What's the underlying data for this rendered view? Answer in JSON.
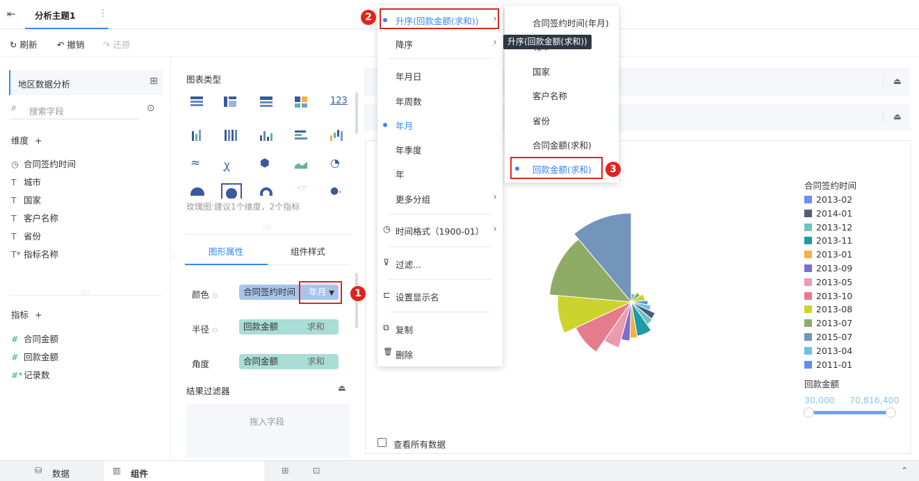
{
  "header": {
    "tab_title": "分析主题1",
    "more": "⋮"
  },
  "toolbar": {
    "refresh": "刷新",
    "undo": "撤销",
    "redo": "还原"
  },
  "left_panel": {
    "package": "地区数据分析",
    "search_placeholder": "搜索字段",
    "dimensions_label": "维度",
    "dimensions": [
      {
        "icon": "◷",
        "name": "合同签约时间"
      },
      {
        "icon": "T",
        "name": "城市"
      },
      {
        "icon": "T",
        "name": "国家"
      },
      {
        "icon": "T",
        "name": "客户名称"
      },
      {
        "icon": "T",
        "name": "省份"
      },
      {
        "icon": "T*",
        "name": "指标名称"
      }
    ],
    "measures_label": "指标",
    "measures": [
      {
        "icon": "#",
        "name": "合同金额"
      },
      {
        "icon": "#",
        "name": "回款金额"
      },
      {
        "icon": "#*",
        "name": "记录数"
      }
    ]
  },
  "mid_panel": {
    "chart_type_label": "图表类型",
    "chart_hint": "玫瑰图:建议1个维度，2个指标",
    "tabs": [
      "图形属性",
      "组件样式"
    ],
    "props": [
      {
        "label": "颜色",
        "field": "合同签约时间",
        "agg": "年月"
      },
      {
        "label": "半径",
        "field": "回款金额",
        "agg": "求和"
      },
      {
        "label": "角度",
        "field": "合同金额",
        "agg": "求和"
      }
    ],
    "filter_label": "结果过滤器",
    "drop_hint": "拖入字段"
  },
  "menu_main": {
    "items": [
      {
        "label": "升序(回款金额(求和))",
        "selected": true,
        "arrow": true
      },
      {
        "label": "降序",
        "arrow": true
      },
      {
        "label": "年月日"
      },
      {
        "label": "年周数"
      },
      {
        "label": "年月",
        "selected": true
      },
      {
        "label": "年季度"
      },
      {
        "label": "年"
      },
      {
        "label": "更多分组",
        "arrow": true
      },
      {
        "label": "时间格式（1900-01）",
        "arrow": true,
        "icon": "◷"
      },
      {
        "label": "过滤...",
        "icon": "⊽"
      },
      {
        "label": "设置显示名",
        "icon": "⊏"
      },
      {
        "label": "复制",
        "icon": "⧉"
      },
      {
        "label": "删除",
        "icon": "🗑"
      }
    ]
  },
  "menu_sub": {
    "items": [
      {
        "label": "合同签约时间(年月)"
      },
      {
        "label": "城市"
      },
      {
        "label": "国家"
      },
      {
        "label": "客户名称"
      },
      {
        "label": "省份"
      },
      {
        "label": "合同金额(求和)"
      },
      {
        "label": "回款金额(求和)",
        "selected": true
      }
    ],
    "tooltip": "升序(回款金额(求和))"
  },
  "annotations": {
    "b1": "1",
    "b2": "2",
    "b3": "3"
  },
  "chart_data": {
    "type": "rose",
    "legend_title": "合同签约时间",
    "categories": [
      "2013-02",
      "2014-01",
      "2013-12",
      "2013-11",
      "2013-01",
      "2013-09",
      "2013-05",
      "2013-10",
      "2013-08",
      "2013-07",
      "2015-07",
      "2013-04",
      "2011-01"
    ],
    "colors": [
      "#6d8fe8",
      "#4e5c7e",
      "#6ec4bd",
      "#1e9aa8",
      "#f5b041",
      "#7b6fce",
      "#ea9bb0",
      "#e57c8c",
      "#cdd32e",
      "#8fac66",
      "#7395bb",
      "#6bc1e1",
      "#5b8ef0"
    ],
    "size_title": "回款金额",
    "size_range": [
      "30,000",
      "70,816,400"
    ],
    "show_all": "查看所有数据"
  },
  "bottom": {
    "data_tab": "数据",
    "component_tab": "组件"
  }
}
